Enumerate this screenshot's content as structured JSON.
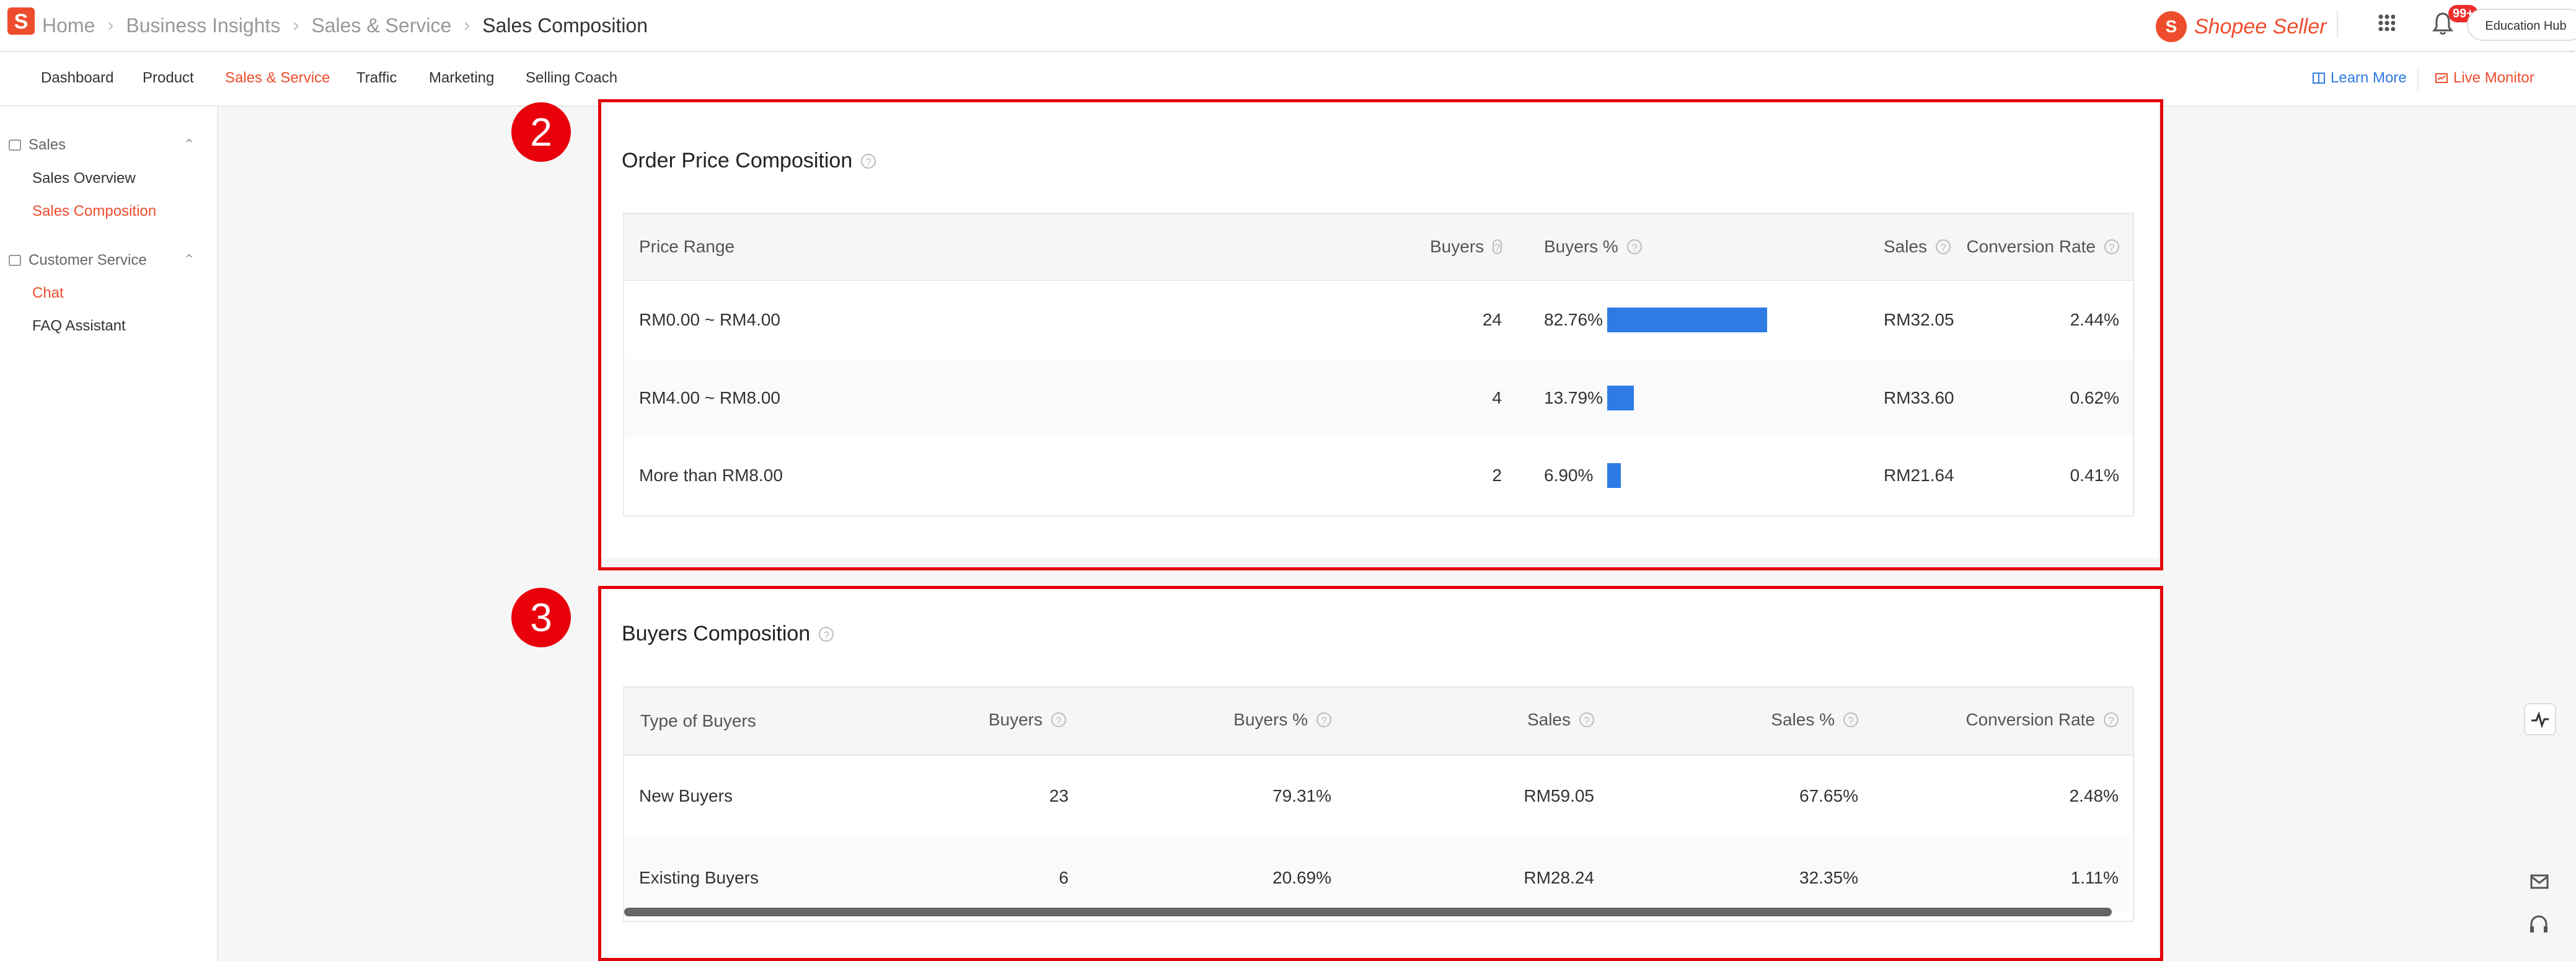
{
  "header": {
    "logo_glyph": "S",
    "breadcrumb": [
      "Home",
      "Business Insights",
      "Sales & Service",
      "Sales Composition"
    ],
    "brand_glyph": "S",
    "brand_name": "Shopee Seller",
    "notif_badge": "99+",
    "education_hub": "Education Hub"
  },
  "tabs": [
    "Dashboard",
    "Product",
    "Sales & Service",
    "Traffic",
    "Marketing",
    "Selling Coach"
  ],
  "active_tab": "Sales & Service",
  "actions": {
    "learn_more": "Learn More",
    "live_monitor": "Live Monitor"
  },
  "sidebar": {
    "groups": [
      {
        "label": "Sales",
        "items": [
          "Sales Overview",
          "Sales Composition"
        ]
      },
      {
        "label": "Customer Service",
        "items": [
          "Chat",
          "FAQ Assistant"
        ]
      }
    ],
    "active_items": [
      "Sales Composition",
      "Chat"
    ]
  },
  "markers": [
    "2",
    "3"
  ],
  "order_price": {
    "title": "Order Price Composition",
    "columns": [
      "Price Range",
      "Buyers",
      "Buyers %",
      "Sales",
      "Conversion Rate"
    ],
    "rows": [
      {
        "range": "RM0.00 ~ RM4.00",
        "buyers": "24",
        "buyers_pct": "82.76%",
        "pct_value": 82.76,
        "sales": "RM32.05",
        "conversion": "2.44%"
      },
      {
        "range": "RM4.00 ~ RM8.00",
        "buyers": "4",
        "buyers_pct": "13.79%",
        "pct_value": 13.79,
        "sales": "RM33.60",
        "conversion": "0.62%"
      },
      {
        "range": "More than RM8.00",
        "buyers": "2",
        "buyers_pct": "6.90%",
        "pct_value": 6.9,
        "sales": "RM21.64",
        "conversion": "0.41%"
      }
    ]
  },
  "buyers_comp": {
    "title": "Buyers Composition",
    "columns": [
      "Type of Buyers",
      "Buyers",
      "Buyers %",
      "Sales",
      "Sales %",
      "Conversion Rate"
    ],
    "rows": [
      {
        "type": "New Buyers",
        "buyers": "23",
        "buyers_pct": "79.31%",
        "sales": "RM59.05",
        "sales_pct": "67.65%",
        "conversion": "2.48%"
      },
      {
        "type": "Existing Buyers",
        "buyers": "6",
        "buyers_pct": "20.69%",
        "sales": "RM28.24",
        "sales_pct": "32.35%",
        "conversion": "1.11%"
      }
    ]
  },
  "colors": {
    "brand": "#ee4d2d",
    "bar": "#2f7be5",
    "highlight": "#e3000b",
    "link": "#2f7be5"
  }
}
